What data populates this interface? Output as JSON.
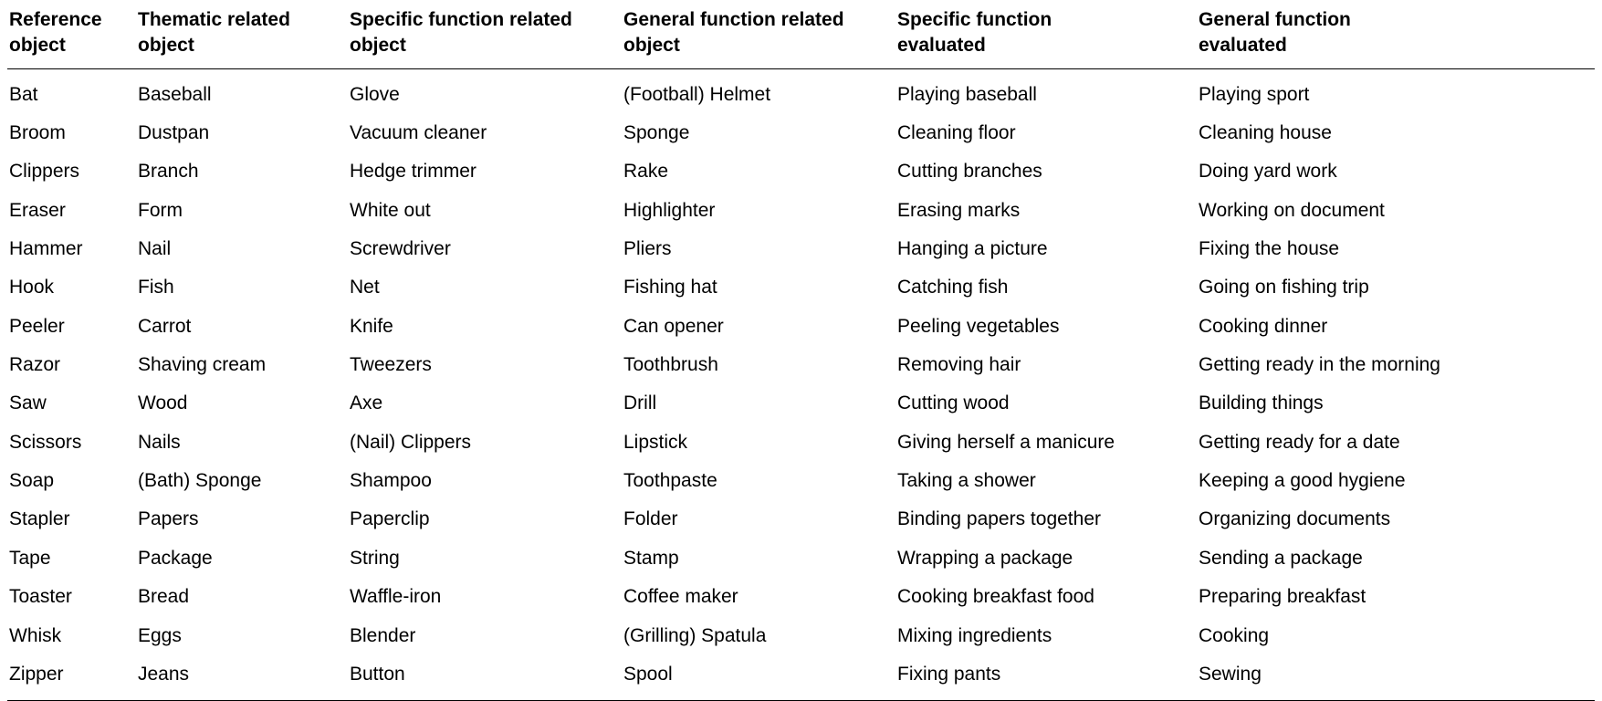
{
  "headers": [
    {
      "line1": "Reference",
      "line2": "object"
    },
    {
      "line1": "Thematic related",
      "line2": "object"
    },
    {
      "line1": "Specific function related",
      "line2": "object"
    },
    {
      "line1": "General function related",
      "line2": "object"
    },
    {
      "line1": "Specific function",
      "line2": "evaluated"
    },
    {
      "line1": "General function",
      "line2": "evaluated"
    }
  ],
  "rows": [
    {
      "c1": "Bat",
      "c2": "Baseball",
      "c3": "Glove",
      "c4": "(Football) Helmet",
      "c5": "Playing baseball",
      "c6": "Playing sport"
    },
    {
      "c1": "Broom",
      "c2": "Dustpan",
      "c3": "Vacuum cleaner",
      "c4": "Sponge",
      "c5": "Cleaning floor",
      "c6": "Cleaning house"
    },
    {
      "c1": "Clippers",
      "c2": "Branch",
      "c3": "Hedge trimmer",
      "c4": "Rake",
      "c5": "Cutting branches",
      "c6": "Doing yard work"
    },
    {
      "c1": "Eraser",
      "c2": "Form",
      "c3": "White out",
      "c4": "Highlighter",
      "c5": "Erasing marks",
      "c6": "Working on document"
    },
    {
      "c1": "Hammer",
      "c2": "Nail",
      "c3": "Screwdriver",
      "c4": "Pliers",
      "c5": "Hanging a picture",
      "c6": "Fixing the house"
    },
    {
      "c1": "Hook",
      "c2": "Fish",
      "c3": "Net",
      "c4": "Fishing hat",
      "c5": "Catching fish",
      "c6": "Going on fishing trip"
    },
    {
      "c1": "Peeler",
      "c2": "Carrot",
      "c3": "Knife",
      "c4": "Can opener",
      "c5": "Peeling vegetables",
      "c6": "Cooking dinner"
    },
    {
      "c1": "Razor",
      "c2": "Shaving cream",
      "c3": "Tweezers",
      "c4": "Toothbrush",
      "c5": "Removing hair",
      "c6": "Getting ready in the morning"
    },
    {
      "c1": "Saw",
      "c2": "Wood",
      "c3": "Axe",
      "c4": "Drill",
      "c5": "Cutting wood",
      "c6": "Building things"
    },
    {
      "c1": "Scissors",
      "c2": "Nails",
      "c3": "(Nail) Clippers",
      "c4": "Lipstick",
      "c5": "Giving herself a manicure",
      "c6": "Getting ready for a date"
    },
    {
      "c1": "Soap",
      "c2": "(Bath) Sponge",
      "c3": "Shampoo",
      "c4": "Toothpaste",
      "c5": "Taking a shower",
      "c6": "Keeping a good hygiene"
    },
    {
      "c1": "Stapler",
      "c2": "Papers",
      "c3": "Paperclip",
      "c4": "Folder",
      "c5": "Binding papers together",
      "c6": "Organizing documents"
    },
    {
      "c1": "Tape",
      "c2": "Package",
      "c3": "String",
      "c4": "Stamp",
      "c5": "Wrapping a package",
      "c6": "Sending a package"
    },
    {
      "c1": "Toaster",
      "c2": "Bread",
      "c3": "Waffle-iron",
      "c4": "Coffee maker",
      "c5": "Cooking breakfast food",
      "c6": "Preparing breakfast"
    },
    {
      "c1": "Whisk",
      "c2": "Eggs",
      "c3": "Blender",
      "c4": "(Grilling) Spatula",
      "c5": "Mixing ingredients",
      "c6": "Cooking"
    },
    {
      "c1": "Zipper",
      "c2": "Jeans",
      "c3": "Button",
      "c4": "Spool",
      "c5": "Fixing pants",
      "c6": "Sewing"
    }
  ]
}
